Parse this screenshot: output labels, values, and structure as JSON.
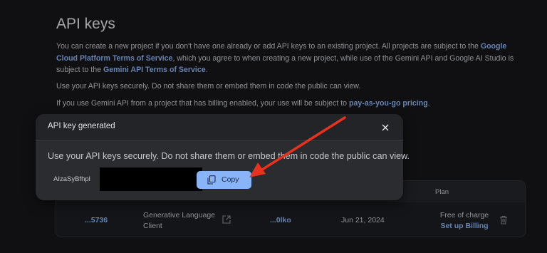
{
  "page": {
    "title": "API keys",
    "intro_text_1": "You can create a new project if you don't have one already or add API keys to an existing project. All projects are subject to the ",
    "intro_link_1": "Google Cloud Platform Terms of Service",
    "intro_text_2": ", which you agree to when creating a new project, while use of the Gemini API and Google AI Studio is subject to the ",
    "intro_link_2": "Gemini API Terms of Service",
    "intro_text_3": ".",
    "secure_note": "Use your API keys securely. Do not share them or embed them in code the public can view.",
    "billing_text": "If you use Gemini API from a project that has billing enabled, your use will be subject to ",
    "billing_link": "pay-as-you-go pricing",
    "billing_end": "."
  },
  "table": {
    "plan_header": "Plan",
    "row": {
      "key_suffix": "...5736",
      "project_name_line1": "Generative Language",
      "project_name_line2": "Client",
      "key_id": "...0lko",
      "date": "Jun 21, 2024",
      "plan": "Free of charge",
      "billing_link": "Set up Billing"
    }
  },
  "dialog": {
    "title": "API key generated",
    "message": "Use your API keys securely. Do not share them or embed them in code the public can view.",
    "key_prefix": "AIzaSyBfhpl",
    "copy_label": "Copy"
  },
  "icons": {
    "close": "close-icon",
    "copy": "copy-icon",
    "external": "open-in-new-icon",
    "delete": "trash-icon"
  },
  "colors": {
    "link": "#8ab4f8",
    "annotation_arrow": "#e8321e",
    "primary_button": "#8ab4f8"
  }
}
